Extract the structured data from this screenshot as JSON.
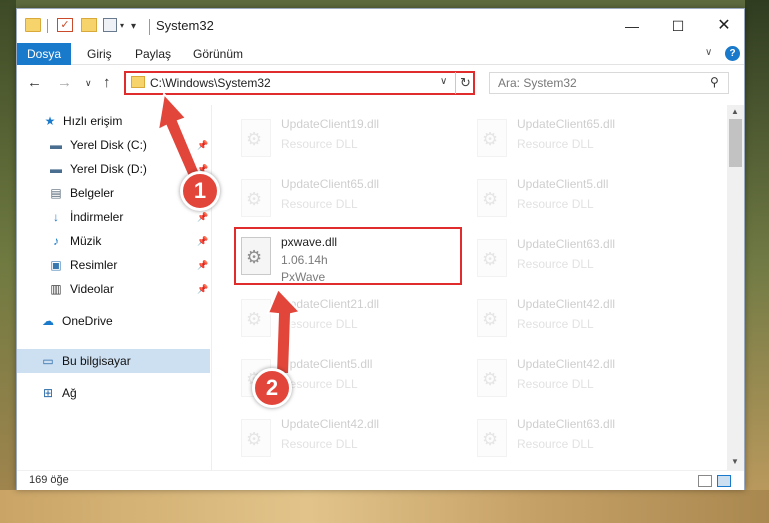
{
  "window": {
    "title": "System32",
    "controls": {
      "minimize": "—",
      "maximize": "☐",
      "close": "✕"
    }
  },
  "ribbon": {
    "tabs": [
      {
        "label": "Dosya"
      },
      {
        "label": "Giriş"
      },
      {
        "label": "Paylaş"
      },
      {
        "label": "Görünüm"
      }
    ],
    "help": "?",
    "expand": "∨"
  },
  "navigation": {
    "back": "←",
    "forward": "→",
    "recent": "∨",
    "up": "↑",
    "address": "C:\\Windows\\System32",
    "refresh": "↻",
    "search_placeholder": "Ara: System32"
  },
  "sidebar": {
    "items": [
      {
        "label": "Hızlı erişim",
        "icon": "star-icon",
        "pinned": false
      },
      {
        "label": "Yerel Disk (C:)",
        "icon": "drive-icon",
        "pinned": true
      },
      {
        "label": "Yerel Disk (D:)",
        "icon": "drive-icon",
        "pinned": true
      },
      {
        "label": "Belgeler",
        "icon": "document-icon",
        "pinned": true
      },
      {
        "label": "İndirmeler",
        "icon": "download-icon",
        "pinned": true
      },
      {
        "label": "Müzik",
        "icon": "music-icon",
        "pinned": true
      },
      {
        "label": "Resimler",
        "icon": "picture-icon",
        "pinned": true
      },
      {
        "label": "Videolar",
        "icon": "video-icon",
        "pinned": true
      },
      {
        "label": "OneDrive",
        "icon": "cloud-icon",
        "pinned": false
      },
      {
        "label": "Bu bilgisayar",
        "icon": "computer-icon",
        "pinned": false,
        "selected": true
      },
      {
        "label": "Ağ",
        "icon": "network-icon",
        "pinned": false
      }
    ]
  },
  "files": [
    {
      "name": "UpdateClient19.dll",
      "type": "Resource DLL"
    },
    {
      "name": "UpdateClient65.dll",
      "type": "Resource DLL"
    },
    {
      "name": "UpdateClient65.dll",
      "type": "Resource DLL"
    },
    {
      "name": "UpdateClient5.dll",
      "type": "Resource DLL"
    },
    {
      "name": "pxwave.dll",
      "version": "1.06.14h",
      "company": "PxWave",
      "highlighted": true
    },
    {
      "name": "UpdateClient63.dll",
      "type": "Resource DLL"
    },
    {
      "name": "UpdateClient21.dll",
      "type": "Resource DLL"
    },
    {
      "name": "UpdateClient42.dll",
      "type": "Resource DLL"
    },
    {
      "name": "UpdateClient5.dll",
      "type": "Resource DLL"
    },
    {
      "name": "UpdateClient42.dll",
      "type": "Resource DLL"
    },
    {
      "name": "UpdateClient42.dll",
      "type": "Resource DLL"
    },
    {
      "name": "UpdateClient63.dll",
      "type": "Resource DLL"
    }
  ],
  "status": {
    "item_count": "169 öğe"
  },
  "annotations": {
    "step1": "1",
    "step2": "2"
  },
  "colors": {
    "accent": "#1979ca",
    "highlight": "#e02c2c",
    "badge": "#e2463b",
    "selection": "#cde0f2"
  }
}
